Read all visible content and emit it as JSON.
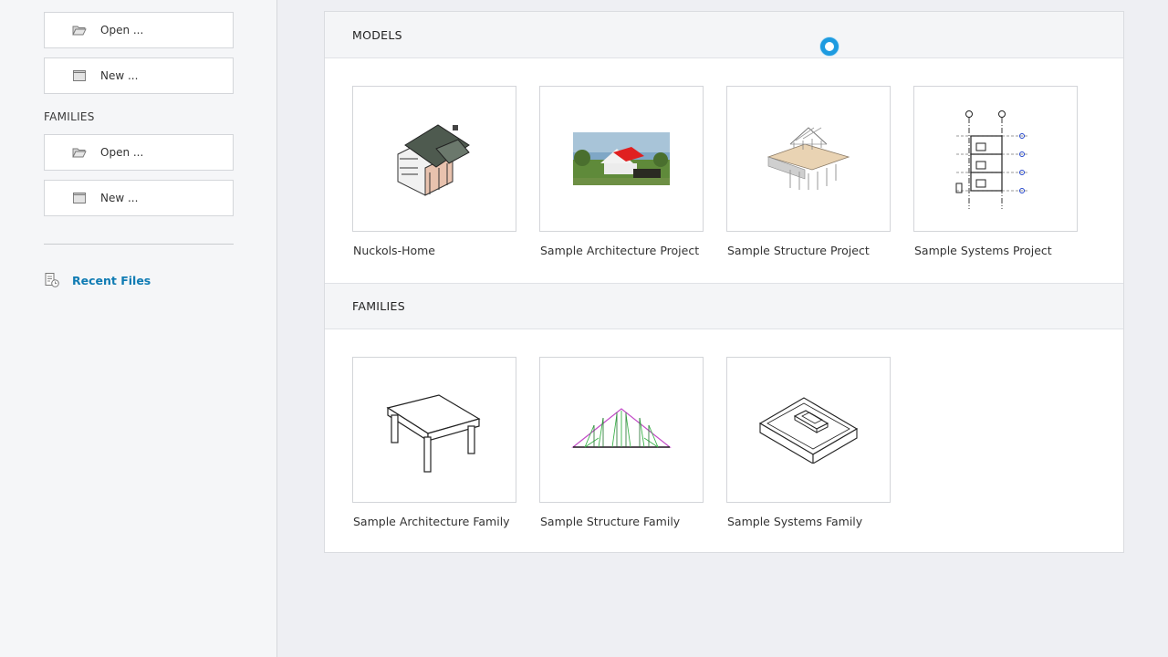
{
  "sidebar": {
    "models_open_label": "Open ...",
    "models_new_label": "New ...",
    "families_heading": "FAMILIES",
    "families_open_label": "Open ...",
    "families_new_label": "New ...",
    "recent_files_label": "Recent Files"
  },
  "main": {
    "models_header": "MODELS",
    "families_header": "FAMILIES",
    "models": [
      {
        "label": "Nuckols-Home",
        "icon": "house-model-thumbnail"
      },
      {
        "label": "Sample Architecture Project",
        "icon": "architecture-render-thumbnail"
      },
      {
        "label": "Sample Structure Project",
        "icon": "structure-model-thumbnail"
      },
      {
        "label": "Sample Systems Project",
        "icon": "systems-section-thumbnail"
      }
    ],
    "families": [
      {
        "label": "Sample Architecture Family",
        "icon": "table-family-thumbnail"
      },
      {
        "label": "Sample Structure Family",
        "icon": "truss-family-thumbnail"
      },
      {
        "label": "Sample Systems Family",
        "icon": "light-fixture-family-thumbnail"
      }
    ]
  },
  "colors": {
    "accent": "#0f7bb3",
    "spinner": "#1e9be0",
    "background": "#eeeff3"
  }
}
